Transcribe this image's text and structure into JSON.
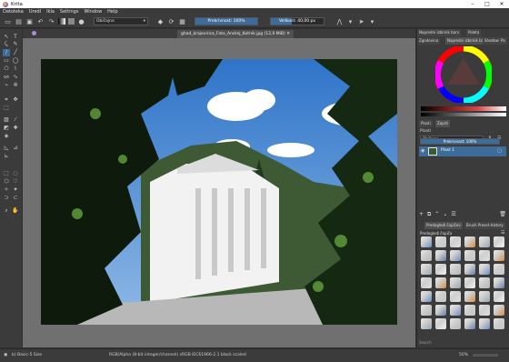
{
  "app": {
    "title": "Krita",
    "window_controls": [
      "–",
      "□",
      "✕"
    ]
  },
  "menubar": [
    "Datoteka",
    "Uredi",
    "Ikla",
    "Settings",
    "Window",
    "Help"
  ],
  "toolbar": {
    "blend_mode": "Običajno",
    "opacity_label": "Prekrivnost: 100%",
    "opacity_value": 1.0,
    "size_label": "Velikost: 40,00 px",
    "size_value": 0.4
  },
  "document": {
    "tab_title": "ghad_krajevnica_Foto_Andrej_Kotnik.jpg (12,0 MiB)"
  },
  "dock": {
    "top_tabs": [
      "Napredni izbirnik barv",
      "Paleta",
      "Zgodovina",
      "Napredni izbirnik bar...",
      "Shadow",
      "Pa"
    ],
    "layers_tabs": [
      "Plasti",
      "Zaprti"
    ],
    "layers_header": "Plasti",
    "blend_mode": "Običajno",
    "opacity_label": "Prekrivnost: 100%",
    "layer_name": "Plast 1",
    "presets_tabs": [
      "Predogledi čopičev",
      "Brush Preset History"
    ],
    "presets_label": "Predogledi čopiča",
    "search_placeholder": "Search"
  },
  "status": {
    "brush": "b) Basic-5 Size",
    "color_info": "RGB/Alpha (8-bit integer/channel)  sRGB IEC61966-2.1 black scaled",
    "zoom": "50%"
  },
  "colors": {
    "accent": "#3d6c9b",
    "panel": "#3b3b3b",
    "canvas_bg": "#707070"
  }
}
